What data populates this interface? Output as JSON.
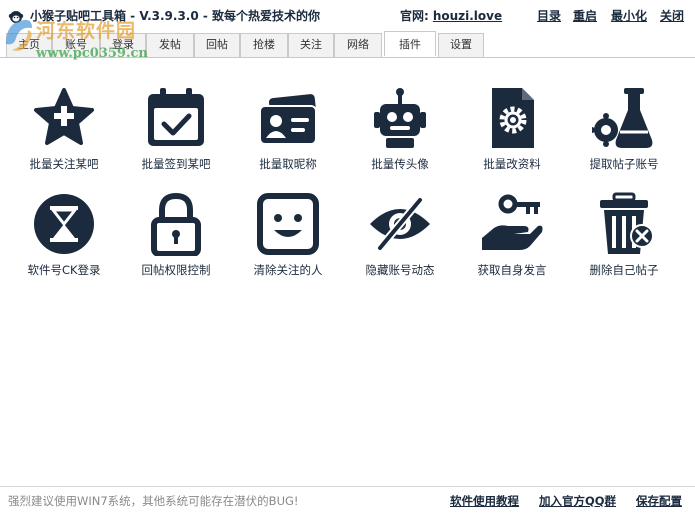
{
  "window": {
    "title": "小猴子贴吧工具箱 - V.3.9.3.0 - 致每个热爱技术的你",
    "site_label": "官网:",
    "site_url": "houzi.love",
    "buttons": {
      "catalog": "目录",
      "restart": "重启",
      "minimize": "最小化",
      "close": "关闭"
    }
  },
  "watermark": {
    "name": "河东软件园",
    "url": "www.pc0359.cn"
  },
  "tabs": [
    {
      "label": "主页"
    },
    {
      "label": "账号"
    },
    {
      "label": "登录"
    },
    {
      "label": "发帖"
    },
    {
      "label": "回帖"
    },
    {
      "label": "抢楼"
    },
    {
      "label": "关注"
    },
    {
      "label": "网络"
    },
    {
      "label": "插件"
    },
    {
      "label": "设置"
    }
  ],
  "active_tab": "插件",
  "plugins": [
    {
      "label": "批量关注某吧",
      "icon": "star-plus-icon"
    },
    {
      "label": "批量签到某吧",
      "icon": "calendar-check-icon"
    },
    {
      "label": "批量取昵称",
      "icon": "id-card-icon"
    },
    {
      "label": "批量传头像",
      "icon": "robot-icon"
    },
    {
      "label": "批量改资料",
      "icon": "document-gear-icon"
    },
    {
      "label": "提取帖子账号",
      "icon": "flask-gear-icon"
    },
    {
      "label": "软件号CK登录",
      "icon": "hourglass-icon"
    },
    {
      "label": "回帖权限控制",
      "icon": "padlock-icon"
    },
    {
      "label": "清除关注的人",
      "icon": "smiley-icon"
    },
    {
      "label": "隐藏账号动态",
      "icon": "eye-slash-icon"
    },
    {
      "label": "获取自身发言",
      "icon": "hand-key-icon"
    },
    {
      "label": "删除自己帖子",
      "icon": "trash-delete-icon"
    }
  ],
  "footer": {
    "note": "强烈建议使用WIN7系统，其他系统可能存在潜伏的BUG!",
    "links": {
      "tutorial": "软件使用教程",
      "qq_group": "加入官方QQ群",
      "save_config": "保存配置"
    }
  },
  "colors": {
    "icon": "#1b2a3d",
    "text": "#1b2a3d",
    "muted": "#8a8a8a",
    "watermark_orange": "#e3a33b",
    "watermark_green": "#3aa14a"
  }
}
